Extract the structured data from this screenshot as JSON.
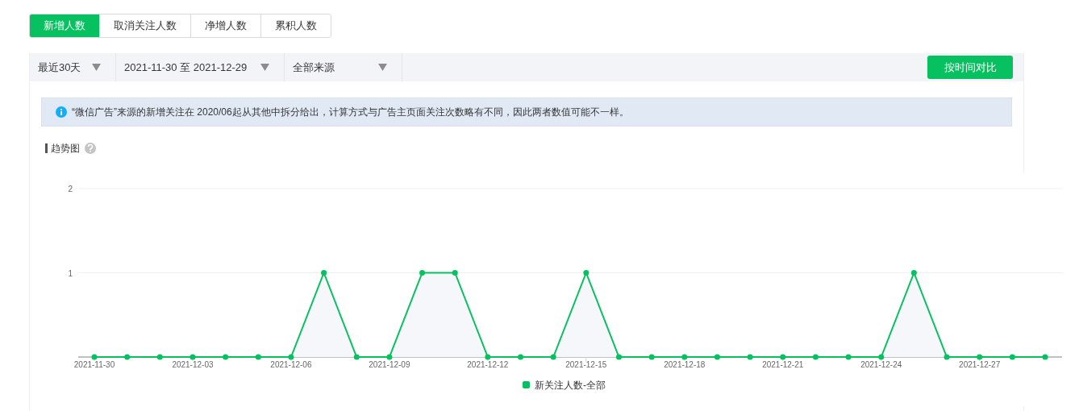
{
  "tabs": [
    {
      "label": "新增人数",
      "selected": true
    },
    {
      "label": "取消关注人数",
      "selected": false
    },
    {
      "label": "净增人数",
      "selected": false
    },
    {
      "label": "累积人数",
      "selected": false
    }
  ],
  "filters": [
    {
      "value": "最近30天"
    },
    {
      "value": "2021-11-30 至 2021-12-29"
    },
    {
      "value": "全部来源"
    }
  ],
  "compare_button": "按时间对比",
  "notice": "“微信广告”来源的新增关注在 2020/06起从其他中拆分给出，计算方式与广告主页面关注次数略有不同，因此两者数值可能不一样。",
  "section_title": "趋势图",
  "chart_data": {
    "type": "line",
    "categories": [
      "2021-11-30",
      null,
      null,
      "2021-12-03",
      null,
      null,
      "2021-12-06",
      null,
      null,
      "2021-12-09",
      null,
      null,
      "2021-12-12",
      null,
      null,
      "2021-12-15",
      null,
      null,
      "2021-12-18",
      null,
      null,
      "2021-12-21",
      null,
      null,
      "2021-12-24",
      null,
      null,
      "2021-12-27",
      null,
      null
    ],
    "series": [
      {
        "name": "新关注人数-全部",
        "color": "#07c160",
        "marker": "circle",
        "values": [
          0,
          0,
          0,
          0,
          0,
          0,
          0,
          1,
          0,
          0,
          1,
          1,
          0,
          0,
          0,
          1,
          0,
          0,
          0,
          0,
          0,
          0,
          0,
          0,
          0,
          1,
          0,
          0,
          0,
          0
        ]
      }
    ],
    "ylim": [
      0,
      2
    ],
    "yticks": [
      1,
      2
    ]
  }
}
